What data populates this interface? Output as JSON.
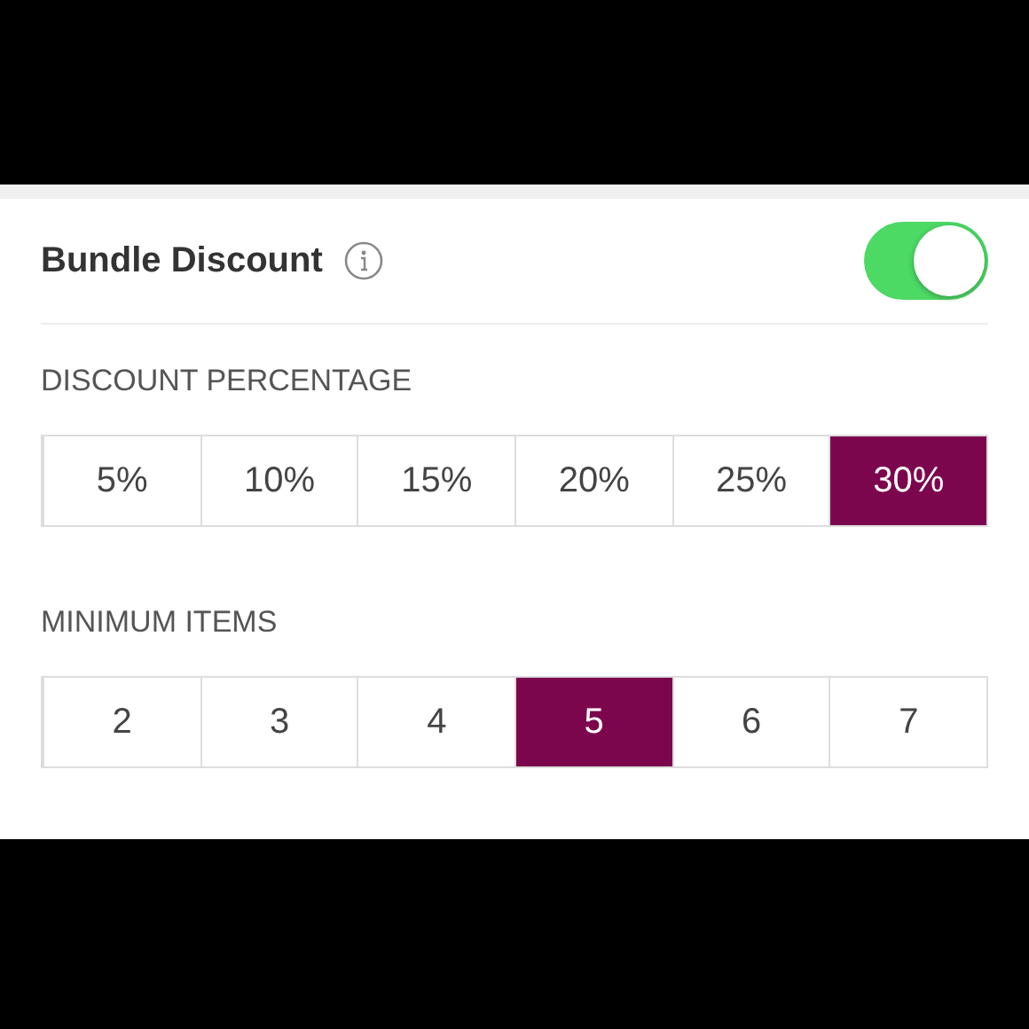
{
  "title": "Bundle Discount",
  "enabled": true,
  "sections": [
    {
      "label": "DISCOUNT PERCENTAGE",
      "options": [
        {
          "label": "5%",
          "selected": false
        },
        {
          "label": "10%",
          "selected": false
        },
        {
          "label": "15%",
          "selected": false
        },
        {
          "label": "20%",
          "selected": false
        },
        {
          "label": "25%",
          "selected": false
        },
        {
          "label": "30%",
          "selected": true
        }
      ]
    },
    {
      "label": "MINIMUM ITEMS",
      "options": [
        {
          "label": "2",
          "selected": false
        },
        {
          "label": "3",
          "selected": false
        },
        {
          "label": "4",
          "selected": false
        },
        {
          "label": "5",
          "selected": true
        },
        {
          "label": "6",
          "selected": false
        },
        {
          "label": "7",
          "selected": false
        }
      ]
    }
  ]
}
